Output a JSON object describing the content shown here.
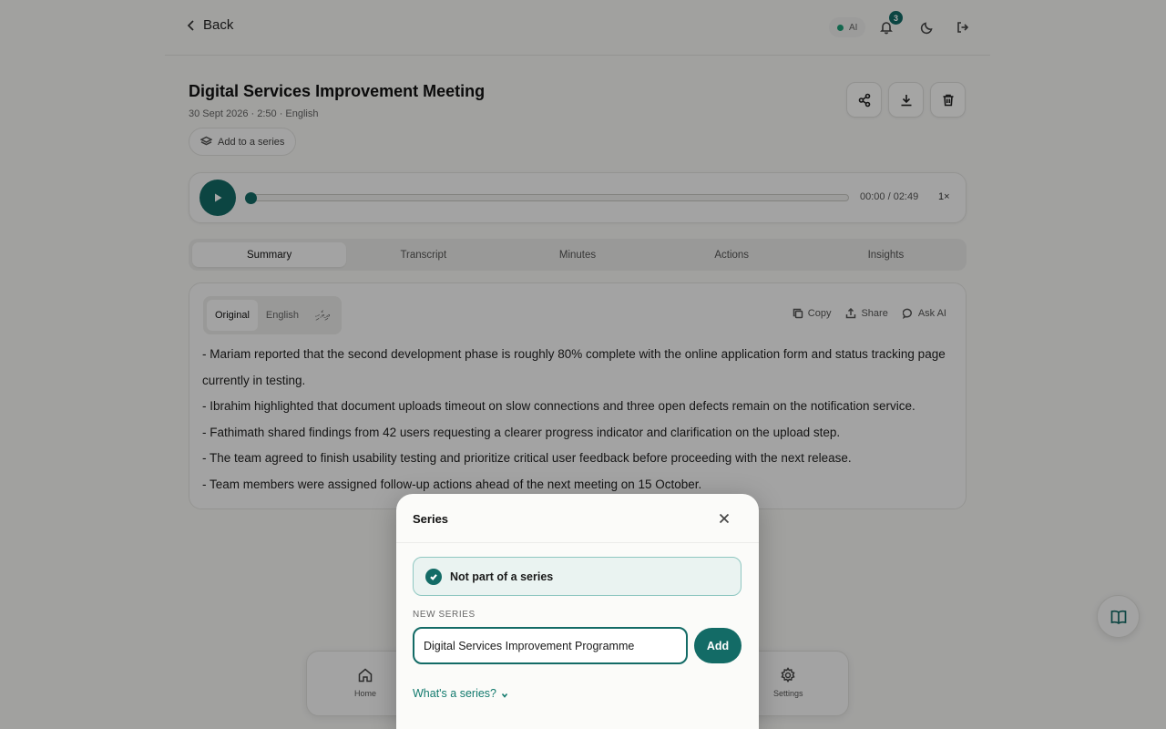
{
  "header": {
    "back_label": "Back",
    "ai_label": "AI",
    "notification_count": "3"
  },
  "meeting": {
    "title": "Digital Services Improvement Meeting",
    "meta": "30 Sept 2026 · 2:50 · English",
    "add_series_label": "Add to a series"
  },
  "player": {
    "time": "00:00 / 02:49",
    "speed": "1×",
    "progress": 0
  },
  "tabs": [
    {
      "label": "Summary"
    },
    {
      "label": "Transcript"
    },
    {
      "label": "Minutes"
    },
    {
      "label": "Actions"
    },
    {
      "label": "Insights"
    }
  ],
  "summary": {
    "languages": [
      {
        "label": "Original"
      },
      {
        "label": "English"
      },
      {
        "label": "ދިވެހި"
      }
    ],
    "tools": {
      "copy": "Copy",
      "share": "Share",
      "ask_ai": "Ask AI"
    },
    "lines": [
      "- Mariam reported that the second development phase is roughly 80% complete with the online application form and status tracking page currently in testing.",
      "- Ibrahim highlighted that document uploads timeout on slow connections and three open defects remain on the notification service.",
      "- Fathimath shared findings from 42 users requesting a clearer progress indicator and clarification on the upload step.",
      "- The team agreed to finish usability testing and prioritize critical user feedback before proceeding with the next release.",
      "- Team members were assigned follow-up actions ahead of the next meeting on 15 October."
    ]
  },
  "nav": {
    "home": "Home",
    "settings": "Settings"
  },
  "modal": {
    "title": "Series",
    "selected_option": "Not part of a series",
    "new_series_label": "NEW SERIES",
    "input_value": "Digital Services Improvement Programme",
    "add_label": "Add",
    "help_link": "What's a series?"
  },
  "colors": {
    "accent": "#136b66",
    "background": "#f7f7f5"
  }
}
